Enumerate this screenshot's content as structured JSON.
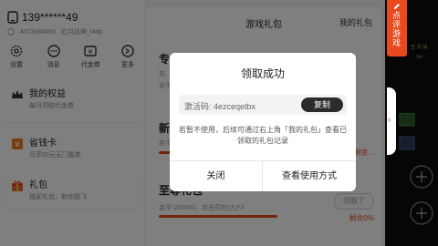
{
  "account": {
    "phone": "139******49",
    "id_text": "4073388460",
    "character": "红月战神_t4dp"
  },
  "quick_actions": [
    {
      "label": "设置",
      "icon": "gear-icon"
    },
    {
      "label": "消息",
      "icon": "message-icon"
    },
    {
      "label": "代金券",
      "icon": "coupon-icon"
    },
    {
      "label": "更多",
      "icon": "more-icon"
    }
  ],
  "menu": {
    "benefits": {
      "title": "我的权益",
      "subtitle": "每月领取代金券"
    },
    "save_card": {
      "title": "省钱卡",
      "subtitle": "月享60元无门槛券"
    },
    "gift": {
      "title": "礼包",
      "subtitle": "独家礼包，助你超飞"
    }
  },
  "gift_panel": {
    "title": "游戏礼包",
    "my_gifts": "我的礼包",
    "items": [
      {
        "name": "专",
        "desc": "攻...",
        "desc2": "金币..."
      },
      {
        "name": "新",
        "desc": "金币...",
        "remain": "剩余..."
      },
      {
        "name": "至尊礼包",
        "desc": "金币*200000，攻击药剂(大)*3",
        "remain": "剩余0%",
        "remain_fraction": 0.0,
        "button": "领取了"
      }
    ]
  },
  "dialog": {
    "title": "领取成功",
    "code_label": "激活码: 4ezceqetbx",
    "copy_label": "复制",
    "tip": "若暂不使用，后续可通过右上角「我的礼包」查看已领取的礼包记录",
    "close_label": "关闭",
    "view_label": "查看使用方式"
  },
  "side_flag": {
    "text": "点评游戏"
  },
  "game_bg": {
    "text1": "王·月·战",
    "text2": "1/4"
  },
  "colors": {
    "accent": "#e8491d",
    "overlay": "rgba(0,0,0,0.5)",
    "copy_button": "#2b2b2b"
  }
}
